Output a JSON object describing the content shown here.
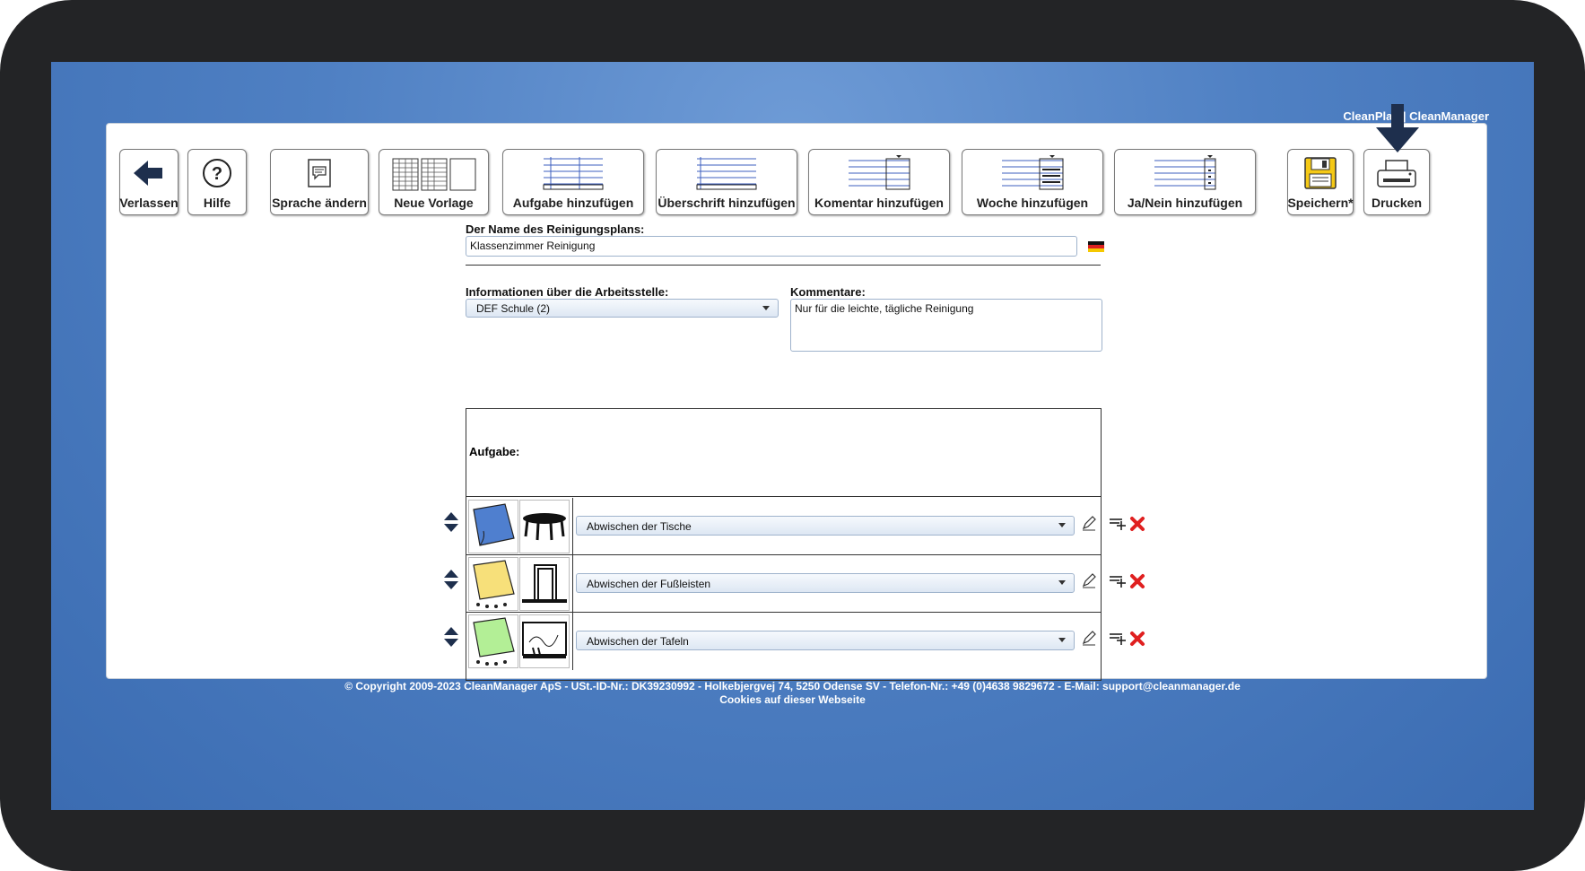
{
  "brand": "CleanPlan | CleanManager",
  "toolbar": {
    "back": "Verlassen",
    "help": "Hilfe",
    "language": "Sprache ändern",
    "new_template": "Neue Vorlage",
    "add_task": "Aufgabe hinzufügen",
    "add_heading": "Überschrift hinzufügen",
    "add_comment": "Komentar hinzufügen",
    "add_week": "Woche hinzufügen",
    "add_yesno": "Ja/Nein hinzufügen",
    "save": "Speichern*",
    "print": "Drucken"
  },
  "form": {
    "plan_name_label": "Der Name des Reinigungsplans:",
    "plan_name_value": "Klassenzimmer Reinigung",
    "workplace_label": "Informationen über die Arbeitsstelle:",
    "workplace_value": "DEF Schule (2)",
    "comments_label": "Kommentare:",
    "comments_value": "Nur für die leichte, tägliche Reinigung"
  },
  "tasks": {
    "header": "Aufgabe:",
    "rows": [
      {
        "label": "Abwischen der Tische",
        "cloth_color": "#4f7fcf",
        "icon": "table-icon"
      },
      {
        "label": "Abwischen der Fußleisten",
        "cloth_color": "#f7e07a",
        "icon": "baseboard-icon"
      },
      {
        "label": "Abwischen der Tafeln",
        "cloth_color": "#b3ef96",
        "icon": "blackboard-icon"
      }
    ]
  },
  "footer": {
    "copyright": "© Copyright 2009-2023 CleanManager ApS - USt.-ID-Nr.: DK39230992 - Holkebjergvej 74, 5250 Odense SV - Telefon-Nr.: +49 (0)4638 9829672 - E-Mail: support@cleanmanager.de",
    "cookies": "Cookies auf dieser Webseite"
  },
  "colors": {
    "background_blue": "#4f80c3",
    "delete_red": "#e02020",
    "arrow_navy": "#1e2f4d"
  }
}
